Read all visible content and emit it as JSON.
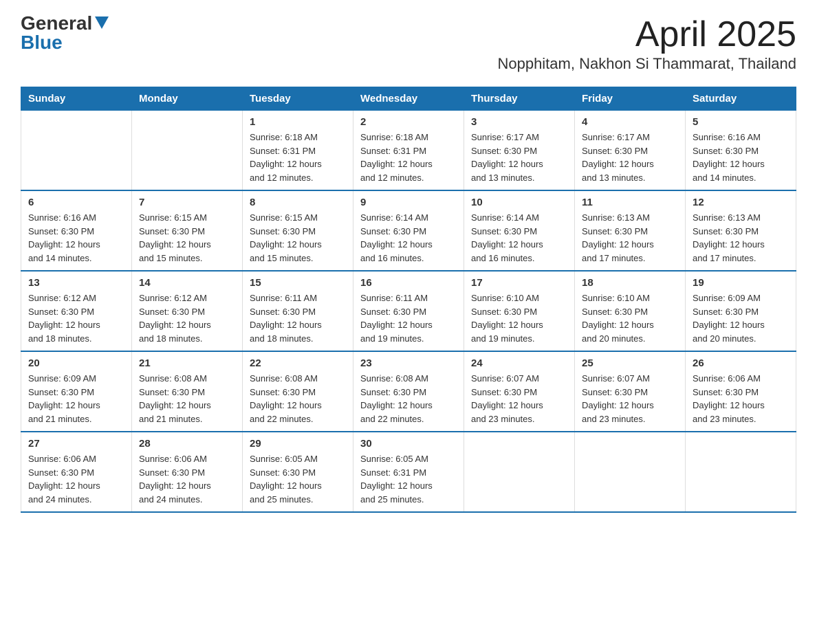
{
  "logo": {
    "general": "General",
    "blue": "Blue"
  },
  "title": "April 2025",
  "subtitle": "Nopphitam, Nakhon Si Thammarat, Thailand",
  "days_header": [
    "Sunday",
    "Monday",
    "Tuesday",
    "Wednesday",
    "Thursday",
    "Friday",
    "Saturday"
  ],
  "weeks": [
    [
      {
        "day": "",
        "info": ""
      },
      {
        "day": "",
        "info": ""
      },
      {
        "day": "1",
        "info": "Sunrise: 6:18 AM\nSunset: 6:31 PM\nDaylight: 12 hours\nand 12 minutes."
      },
      {
        "day": "2",
        "info": "Sunrise: 6:18 AM\nSunset: 6:31 PM\nDaylight: 12 hours\nand 12 minutes."
      },
      {
        "day": "3",
        "info": "Sunrise: 6:17 AM\nSunset: 6:30 PM\nDaylight: 12 hours\nand 13 minutes."
      },
      {
        "day": "4",
        "info": "Sunrise: 6:17 AM\nSunset: 6:30 PM\nDaylight: 12 hours\nand 13 minutes."
      },
      {
        "day": "5",
        "info": "Sunrise: 6:16 AM\nSunset: 6:30 PM\nDaylight: 12 hours\nand 14 minutes."
      }
    ],
    [
      {
        "day": "6",
        "info": "Sunrise: 6:16 AM\nSunset: 6:30 PM\nDaylight: 12 hours\nand 14 minutes."
      },
      {
        "day": "7",
        "info": "Sunrise: 6:15 AM\nSunset: 6:30 PM\nDaylight: 12 hours\nand 15 minutes."
      },
      {
        "day": "8",
        "info": "Sunrise: 6:15 AM\nSunset: 6:30 PM\nDaylight: 12 hours\nand 15 minutes."
      },
      {
        "day": "9",
        "info": "Sunrise: 6:14 AM\nSunset: 6:30 PM\nDaylight: 12 hours\nand 16 minutes."
      },
      {
        "day": "10",
        "info": "Sunrise: 6:14 AM\nSunset: 6:30 PM\nDaylight: 12 hours\nand 16 minutes."
      },
      {
        "day": "11",
        "info": "Sunrise: 6:13 AM\nSunset: 6:30 PM\nDaylight: 12 hours\nand 17 minutes."
      },
      {
        "day": "12",
        "info": "Sunrise: 6:13 AM\nSunset: 6:30 PM\nDaylight: 12 hours\nand 17 minutes."
      }
    ],
    [
      {
        "day": "13",
        "info": "Sunrise: 6:12 AM\nSunset: 6:30 PM\nDaylight: 12 hours\nand 18 minutes."
      },
      {
        "day": "14",
        "info": "Sunrise: 6:12 AM\nSunset: 6:30 PM\nDaylight: 12 hours\nand 18 minutes."
      },
      {
        "day": "15",
        "info": "Sunrise: 6:11 AM\nSunset: 6:30 PM\nDaylight: 12 hours\nand 18 minutes."
      },
      {
        "day": "16",
        "info": "Sunrise: 6:11 AM\nSunset: 6:30 PM\nDaylight: 12 hours\nand 19 minutes."
      },
      {
        "day": "17",
        "info": "Sunrise: 6:10 AM\nSunset: 6:30 PM\nDaylight: 12 hours\nand 19 minutes."
      },
      {
        "day": "18",
        "info": "Sunrise: 6:10 AM\nSunset: 6:30 PM\nDaylight: 12 hours\nand 20 minutes."
      },
      {
        "day": "19",
        "info": "Sunrise: 6:09 AM\nSunset: 6:30 PM\nDaylight: 12 hours\nand 20 minutes."
      }
    ],
    [
      {
        "day": "20",
        "info": "Sunrise: 6:09 AM\nSunset: 6:30 PM\nDaylight: 12 hours\nand 21 minutes."
      },
      {
        "day": "21",
        "info": "Sunrise: 6:08 AM\nSunset: 6:30 PM\nDaylight: 12 hours\nand 21 minutes."
      },
      {
        "day": "22",
        "info": "Sunrise: 6:08 AM\nSunset: 6:30 PM\nDaylight: 12 hours\nand 22 minutes."
      },
      {
        "day": "23",
        "info": "Sunrise: 6:08 AM\nSunset: 6:30 PM\nDaylight: 12 hours\nand 22 minutes."
      },
      {
        "day": "24",
        "info": "Sunrise: 6:07 AM\nSunset: 6:30 PM\nDaylight: 12 hours\nand 23 minutes."
      },
      {
        "day": "25",
        "info": "Sunrise: 6:07 AM\nSunset: 6:30 PM\nDaylight: 12 hours\nand 23 minutes."
      },
      {
        "day": "26",
        "info": "Sunrise: 6:06 AM\nSunset: 6:30 PM\nDaylight: 12 hours\nand 23 minutes."
      }
    ],
    [
      {
        "day": "27",
        "info": "Sunrise: 6:06 AM\nSunset: 6:30 PM\nDaylight: 12 hours\nand 24 minutes."
      },
      {
        "day": "28",
        "info": "Sunrise: 6:06 AM\nSunset: 6:30 PM\nDaylight: 12 hours\nand 24 minutes."
      },
      {
        "day": "29",
        "info": "Sunrise: 6:05 AM\nSunset: 6:30 PM\nDaylight: 12 hours\nand 25 minutes."
      },
      {
        "day": "30",
        "info": "Sunrise: 6:05 AM\nSunset: 6:31 PM\nDaylight: 12 hours\nand 25 minutes."
      },
      {
        "day": "",
        "info": ""
      },
      {
        "day": "",
        "info": ""
      },
      {
        "day": "",
        "info": ""
      }
    ]
  ]
}
